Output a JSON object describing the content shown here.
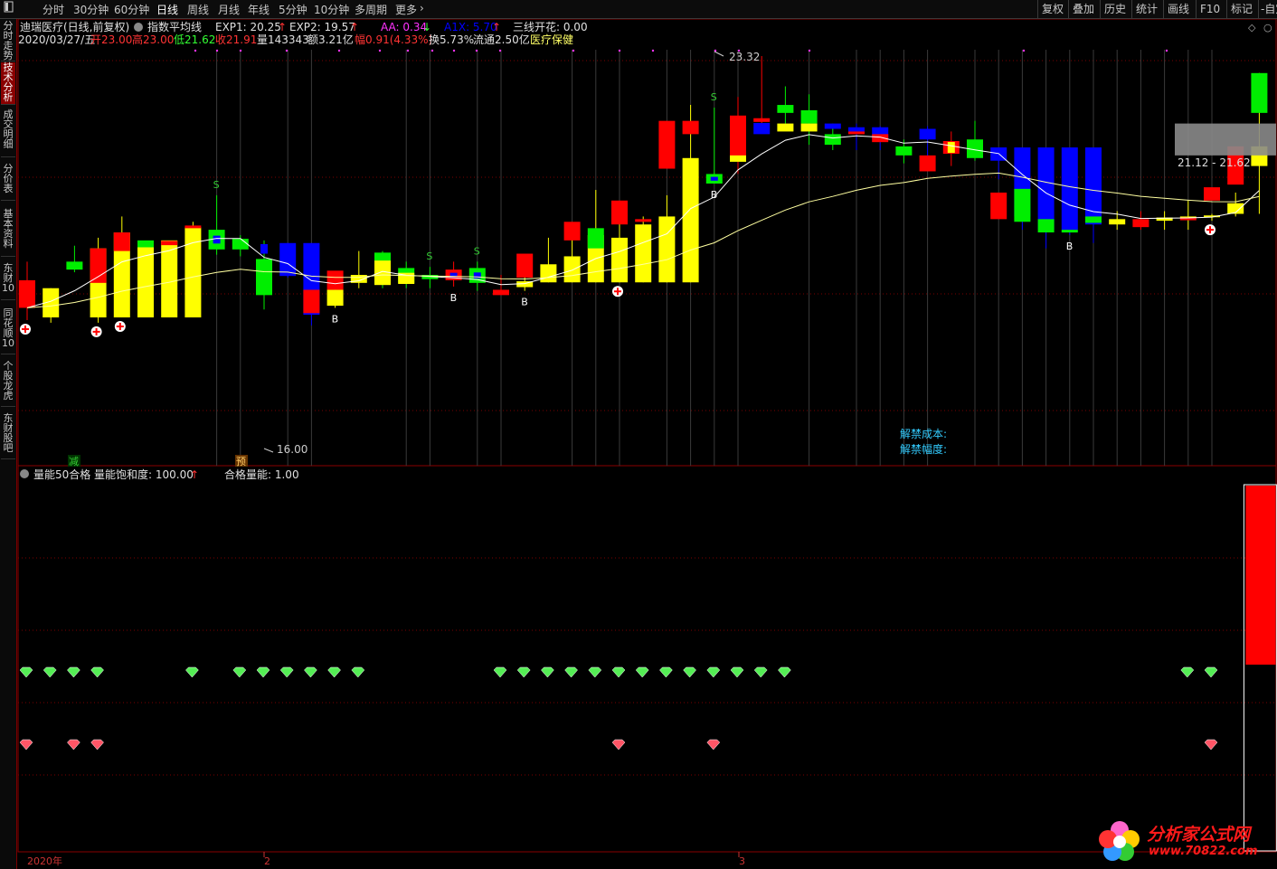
{
  "topbar": {
    "left_icon": "pin-icon",
    "tabs": [
      {
        "label": "分时",
        "active": false
      },
      {
        "label": "30分钟",
        "active": false
      },
      {
        "label": "60分钟",
        "active": false
      },
      {
        "label": "日线",
        "active": true
      },
      {
        "label": "周线",
        "active": false
      },
      {
        "label": "月线",
        "active": false
      },
      {
        "label": "年线",
        "active": false
      },
      {
        "label": "5分钟",
        "active": false
      },
      {
        "label": "10分钟",
        "active": false
      },
      {
        "label": "多周期",
        "active": false
      },
      {
        "label": "更多",
        "active": false
      }
    ],
    "more_icon": "chevron-right-icon",
    "right_buttons": [
      "复权",
      "叠加",
      "历史",
      "统计",
      "画线",
      "F10",
      "标记",
      "-自定"
    ]
  },
  "left_nav": [
    {
      "label": "分时走势",
      "active": false
    },
    {
      "label": "技术分析",
      "active": true
    },
    {
      "label": "成交明细",
      "active": false
    },
    {
      "label": "分价表",
      "active": false
    },
    {
      "label": "基本资料",
      "active": false
    },
    {
      "label": "东财10",
      "active": false
    },
    {
      "label": "同花顺10",
      "active": false
    },
    {
      "label": "个股龙虎",
      "active": false
    },
    {
      "label": "东财股吧",
      "active": false
    }
  ],
  "main_header": {
    "stock": "迪瑞医疗(日线,前复权)",
    "indicator_name": "指数平均线",
    "exp1_label": "EXP1: 20.25",
    "exp2_label": "EXP2: 19.57",
    "aa_label": "AA: 0.34",
    "a1x_label": "A1X: 5.70",
    "sanxian_label": "三线开花: 0.00",
    "date": "2020/03/27/五",
    "open": "开23.00",
    "high": "高23.00",
    "low": "低21.62",
    "close": "收21.91",
    "vol": "量143343",
    "amount": "额3.21亿",
    "change": "幅0.91(4.33%)",
    "turnover": "换5.73%",
    "float": "流通2.50亿",
    "sector": "医疗保健"
  },
  "annotations": {
    "high_label": "23.32",
    "low_label": "16.00",
    "last_range": "21.12 - 21.62",
    "jiejin_cost": "解禁成本:",
    "jiejin_range": "解禁幅度:",
    "jian_label": "减",
    "yu_label": "预"
  },
  "sub_header": {
    "name": "量能50合格",
    "saturation_label": "量能饱和度: 100.00",
    "qualified_label": "合格量能: 1.00"
  },
  "x_axis": {
    "labels": [
      "2020年",
      "2",
      "3"
    ]
  },
  "colors": {
    "up": "#ff0000",
    "down": "#00ee00",
    "yellow": "#ffff00",
    "blue": "#0000ff",
    "ma_white": "#ffffff",
    "ma_pale": "#ffffa0",
    "grid": "#7a0000",
    "frame": "#8a0000"
  },
  "chart_data": {
    "type": "candlestick",
    "price_scale": {
      "min": 16.0,
      "max": 23.32
    },
    "candles": [
      {
        "o": 19.1,
        "h": 19.45,
        "l": 18.35,
        "c": 18.58,
        "color": "red"
      },
      {
        "o": 18.4,
        "h": 18.95,
        "l": 18.3,
        "c": 18.95,
        "color": "yellow"
      },
      {
        "o": 19.45,
        "h": 19.75,
        "l": 19.25,
        "c": 19.3,
        "color": "green"
      },
      {
        "o": 18.4,
        "h": 19.9,
        "l": 18.3,
        "c": 19.7,
        "color": "yellow",
        "body_color": "red",
        "body_o": 19.05,
        "body_c": 19.7
      },
      {
        "o": 18.4,
        "h": 20.3,
        "l": 18.4,
        "c": 20.0,
        "color": "yellow",
        "body_color": "red",
        "body_o": 19.65,
        "body_c": 20.0
      },
      {
        "o": 18.4,
        "h": 19.75,
        "l": 18.4,
        "c": 19.8,
        "color": "yellow",
        "body_color": "green",
        "body_o": 19.72,
        "body_c": 19.85
      },
      {
        "o": 18.4,
        "h": 19.75,
        "l": 18.4,
        "c": 19.85,
        "color": "yellow",
        "body_color": "red",
        "body_o": 19.76,
        "body_c": 19.84
      },
      {
        "o": 18.4,
        "h": 20.2,
        "l": 18.4,
        "c": 20.1,
        "color": "yellow",
        "body_color": "red",
        "body_o": 20.08,
        "body_c": 20.13
      },
      {
        "o": 19.68,
        "h": 20.7,
        "l": 19.58,
        "c": 20.05,
        "color": "green",
        "inner_blue": true
      },
      {
        "o": 19.68,
        "h": 19.95,
        "l": 19.55,
        "c": 19.88,
        "color": "green",
        "body_color": "blue",
        "inner_o": 19.88,
        "inner_c": 19.92
      },
      {
        "o": 19.5,
        "h": 19.85,
        "l": 18.55,
        "c": 18.82,
        "color": "green",
        "inner_blue": true,
        "inner_o": 19.6,
        "inner_c": 19.78
      },
      {
        "o": 19.8,
        "h": 19.8,
        "l": 19.15,
        "c": 19.18,
        "color": "blue"
      },
      {
        "o": 19.8,
        "h": 19.8,
        "l": 18.25,
        "c": 18.45,
        "color": "blue",
        "body_color": "red",
        "body_o": 18.92,
        "body_c": 18.48
      },
      {
        "o": 18.62,
        "h": 19.05,
        "l": 18.58,
        "c": 18.92,
        "color": "yellow",
        "body_color": "red",
        "body_o": 19.28,
        "body_c": 18.92
      },
      {
        "o": 19.05,
        "h": 19.65,
        "l": 18.95,
        "c": 19.2,
        "color": "yellow"
      },
      {
        "o": 19.17,
        "h": 19.65,
        "l": 18.95,
        "c": 19.62,
        "color": "green",
        "body_color": "yellow",
        "body_o": 19.01,
        "body_c": 19.47
      },
      {
        "o": 19.33,
        "h": 19.45,
        "l": 18.95,
        "c": 19.05,
        "color": "green",
        "body_color": "yellow",
        "body_o": 19.03,
        "body_c": 19.24
      },
      {
        "o": 19.2,
        "h": 19.35,
        "l": 18.95,
        "c": 19.12,
        "color": "green"
      },
      {
        "o": 19.3,
        "h": 19.45,
        "l": 18.98,
        "c": 19.1,
        "color": "red",
        "inner_blue": true
      },
      {
        "o": 19.33,
        "h": 19.45,
        "l": 18.9,
        "c": 19.05,
        "color": "green",
        "inner_blue": true
      },
      {
        "o": 18.92,
        "h": 19.2,
        "l": 18.9,
        "c": 18.82,
        "color": "red"
      },
      {
        "o": 18.97,
        "h": 19.2,
        "l": 18.9,
        "c": 19.08,
        "color": "yellow",
        "body_color": "red",
        "body_o": 19.15,
        "body_c": 19.6
      },
      {
        "o": 19.06,
        "h": 19.9,
        "l": 19.06,
        "c": 19.4,
        "color": "yellow"
      },
      {
        "o": 19.06,
        "h": 19.95,
        "l": 19.06,
        "c": 19.55,
        "color": "yellow",
        "body_color": "red",
        "body_o": 19.85,
        "body_c": 20.2
      },
      {
        "o": 19.06,
        "h": 20.8,
        "l": 19.06,
        "c": 19.95,
        "color": "yellow",
        "body_color": "green",
        "body_o": 20.08,
        "body_c": 19.7
      },
      {
        "o": 19.06,
        "h": 20.55,
        "l": 19.06,
        "c": 19.9,
        "color": "yellow",
        "body_color": "red",
        "body_o": 20.15,
        "body_c": 20.6
      },
      {
        "o": 19.06,
        "h": 20.3,
        "l": 19.06,
        "c": 20.15,
        "color": "yellow",
        "body_color": "red",
        "body_o": 20.23,
        "body_c": 20.25
      },
      {
        "o": 19.06,
        "h": 20.7,
        "l": 19.06,
        "c": 20.3,
        "color": "yellow",
        "body_color": "red",
        "body_o": 21.2,
        "body_c": 22.1
      },
      {
        "o": 19.06,
        "h": 22.4,
        "l": 19.06,
        "c": 21.4,
        "color": "yellow",
        "body_color": "red",
        "body_o": 21.85,
        "body_c": 22.1
      },
      {
        "o": 20.92,
        "h": 22.35,
        "l": 20.92,
        "c": 21.1,
        "color": "green",
        "inner_blue": true
      },
      {
        "o": 21.35,
        "h": 22.55,
        "l": 21.1,
        "c": 22.2,
        "color": "red",
        "body_color": "yellow",
        "body_o": 21.33,
        "body_c": 21.45
      },
      {
        "o": 22.15,
        "h": 23.32,
        "l": 21.9,
        "c": 22.08,
        "color": "red",
        "body_color": "blue",
        "body_o": 22.06,
        "body_c": 21.85
      },
      {
        "o": 22.4,
        "h": 22.75,
        "l": 22.05,
        "c": 22.25,
        "color": "green",
        "body_color": "yellow",
        "body_o": 22.05,
        "body_c": 21.9
      },
      {
        "o": 22.3,
        "h": 22.6,
        "l": 21.65,
        "c": 22.05,
        "color": "green",
        "body_color": "yellow",
        "body_o": 22.05,
        "body_c": 21.9
      },
      {
        "o": 21.85,
        "h": 22.05,
        "l": 21.55,
        "c": 21.65,
        "color": "green",
        "body_color": "blue",
        "body_o": 22.05,
        "body_c": 21.95
      },
      {
        "o": 21.98,
        "h": 22.05,
        "l": 21.55,
        "c": 21.9,
        "color": "blue",
        "body_color": "red",
        "body_o": 21.9,
        "body_c": 21.85
      },
      {
        "o": 21.98,
        "h": 22.0,
        "l": 21.55,
        "c": 21.75,
        "color": "blue",
        "body_color": "red",
        "body_o": 21.85,
        "body_c": 21.7
      },
      {
        "o": 21.62,
        "h": 21.75,
        "l": 21.3,
        "c": 21.45,
        "color": "green"
      },
      {
        "o": 21.95,
        "h": 22.0,
        "l": 21.3,
        "c": 21.75,
        "color": "blue",
        "body_color": "red",
        "body_o": 21.45,
        "body_c": 21.15
      },
      {
        "o": 21.72,
        "h": 21.9,
        "l": 21.25,
        "c": 21.48,
        "color": "red",
        "inner_yellow": true
      },
      {
        "o": 21.75,
        "h": 22.1,
        "l": 21.35,
        "c": 21.4,
        "color": "green",
        "body_color": "blue",
        "inner_o": 21.65,
        "inner_c": 21.66
      },
      {
        "o": 21.6,
        "h": 21.6,
        "l": 21.0,
        "c": 21.35,
        "color": "blue",
        "body_color": "red",
        "body_o": 20.75,
        "body_c": 20.25
      },
      {
        "o": 21.6,
        "h": 21.6,
        "l": 20.05,
        "c": 20.3,
        "color": "blue",
        "body_color": "green",
        "body_o": 20.82,
        "body_c": 20.2
      },
      {
        "o": 21.6,
        "h": 21.6,
        "l": 19.7,
        "c": 20.05,
        "color": "blue",
        "body_color": "green",
        "body_o": 20.25,
        "body_c": 20.0
      },
      {
        "o": 21.6,
        "h": 21.6,
        "l": 19.95,
        "c": 20.05,
        "color": "blue",
        "body_color": "green",
        "body_o": 20.05,
        "body_c": 20.04
      },
      {
        "o": 21.6,
        "h": 21.6,
        "l": 19.8,
        "c": 20.15,
        "color": "blue",
        "body_color": "green",
        "body_o": 20.3,
        "body_c": 20.18
      },
      {
        "o": 20.15,
        "h": 20.4,
        "l": 20.05,
        "c": 20.25,
        "color": "yellow"
      },
      {
        "o": 20.25,
        "h": 20.4,
        "l": 20.05,
        "c": 20.1,
        "color": "red"
      },
      {
        "o": 20.22,
        "h": 20.4,
        "l": 20.05,
        "c": 20.28,
        "color": "yellow"
      },
      {
        "o": 20.3,
        "h": 20.6,
        "l": 20.05,
        "c": 20.28,
        "color": "yellow",
        "body_color": "red",
        "body_o": 20.28,
        "body_c": 20.26
      },
      {
        "o": 20.3,
        "h": 20.35,
        "l": 20.22,
        "c": 20.32,
        "color": "yellow",
        "body_color": "red",
        "body_o": 20.6,
        "body_c": 20.85
      },
      {
        "o": 20.35,
        "h": 20.75,
        "l": 20.3,
        "c": 20.55,
        "color": "yellow",
        "body_color": "red",
        "body_o": 20.9,
        "body_c": 21.62
      },
      {
        "o": 21.25,
        "h": 23.0,
        "l": 20.35,
        "c": 21.62,
        "color": "yellow",
        "body_color": "green",
        "body_o": 23.0,
        "body_c": 22.25
      }
    ],
    "signals": {
      "S": [
        8,
        17,
        19,
        29
      ],
      "B": [
        13,
        18,
        21,
        29,
        44
      ],
      "plus": [
        0,
        3,
        4,
        25,
        50
      ]
    },
    "volume_sub": {
      "title": "量能50合格",
      "green_diamonds": [
        0,
        1,
        2,
        3,
        7,
        9,
        10,
        11,
        12,
        13,
        14,
        20,
        21,
        22,
        23,
        24,
        25,
        26,
        27,
        28,
        29,
        30,
        31,
        32,
        49,
        50
      ],
      "red_diamonds": [
        0,
        2,
        3,
        25,
        29,
        50
      ],
      "bar_last": 1.0
    }
  }
}
